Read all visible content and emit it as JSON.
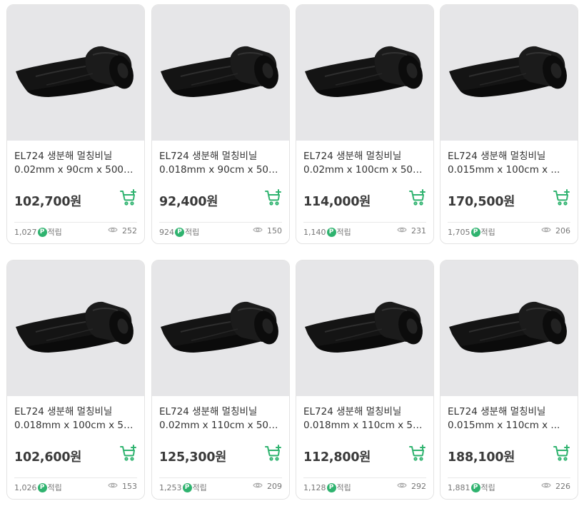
{
  "products": [
    {
      "name": "EL724 생분해 멀칭비닐",
      "spec": "0.02mm x 90cm x 500M...",
      "price": "102,700원",
      "points": "1,027",
      "points_label": "적립",
      "views": "252",
      "point_icon": "P"
    },
    {
      "name": "EL724 생분해 멀칭비닐",
      "spec": "0.018mm x 90cm x 500...",
      "price": "92,400원",
      "points": "924",
      "points_label": "적립",
      "views": "150",
      "point_icon": "P"
    },
    {
      "name": "EL724 생분해 멀칭비닐",
      "spec": "0.02mm x 100cm x 500...",
      "price": "114,000원",
      "points": "1,140",
      "points_label": "적립",
      "views": "231",
      "point_icon": "P"
    },
    {
      "name": "EL724 생분해 멀칭비닐",
      "spec": "0.015mm x 100cm x ...",
      "price": "170,500원",
      "points": "1,705",
      "points_label": "적립",
      "views": "206",
      "point_icon": "P"
    },
    {
      "name": "EL724 생분해 멀칭비닐",
      "spec": "0.018mm x 100cm x 500...",
      "price": "102,600원",
      "points": "1,026",
      "points_label": "적립",
      "views": "153",
      "point_icon": "P"
    },
    {
      "name": "EL724 생분해 멀칭비닐",
      "spec": "0.02mm x 110cm x 500...",
      "price": "125,300원",
      "points": "1,253",
      "points_label": "적립",
      "views": "209",
      "point_icon": "P"
    },
    {
      "name": "EL724 생분해 멀칭비닐",
      "spec": "0.018mm x 110cm x 500...",
      "price": "112,800원",
      "points": "1,128",
      "points_label": "적립",
      "views": "292",
      "point_icon": "P"
    },
    {
      "name": "EL724 생분해 멀칭비닐",
      "spec": "0.015mm x 110cm x ...",
      "price": "188,100원",
      "points": "1,881",
      "points_label": "적립",
      "views": "226",
      "point_icon": "P"
    }
  ],
  "icons": {
    "cart": "cart-plus-icon",
    "views": "eye-icon",
    "points": "point-badge-icon"
  },
  "colors": {
    "accent_green": "#2fb36f",
    "thumb_bg": "#e6e6e8",
    "price_text": "#3a3a3a"
  }
}
